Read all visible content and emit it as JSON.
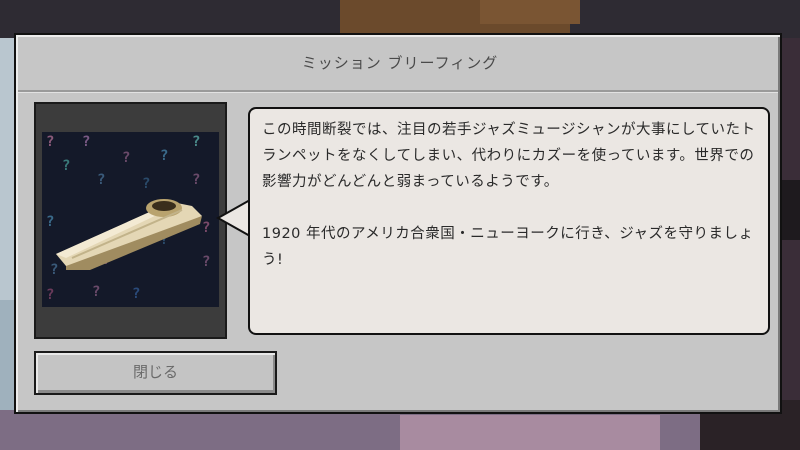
{
  "dialog": {
    "title": "ミッション ブリーフィング",
    "close_label": "閉じる"
  },
  "briefing": {
    "paragraph_1": "この時間断裂では、注目の若手ジャズミュージシャンが大事にしていたトランペットをなくしてしまい、代わりにカズーを使っています。世界での影響力がどんどんと弱まっているようです。",
    "paragraph_2": "1920 年代のアメリカ合衆国・ニューヨークに行き、ジャズを守りましょう!"
  },
  "image": {
    "subject": "kazoo",
    "background_pattern": "question-marks"
  },
  "icons": {
    "audio_button": "book-speaker-icon"
  },
  "colors": {
    "dialog_bg": "#c6c6c6",
    "bubble_bg": "#ebe7e3",
    "title_text": "#4a4a4a",
    "disabled_text": "#6a6a6a"
  }
}
